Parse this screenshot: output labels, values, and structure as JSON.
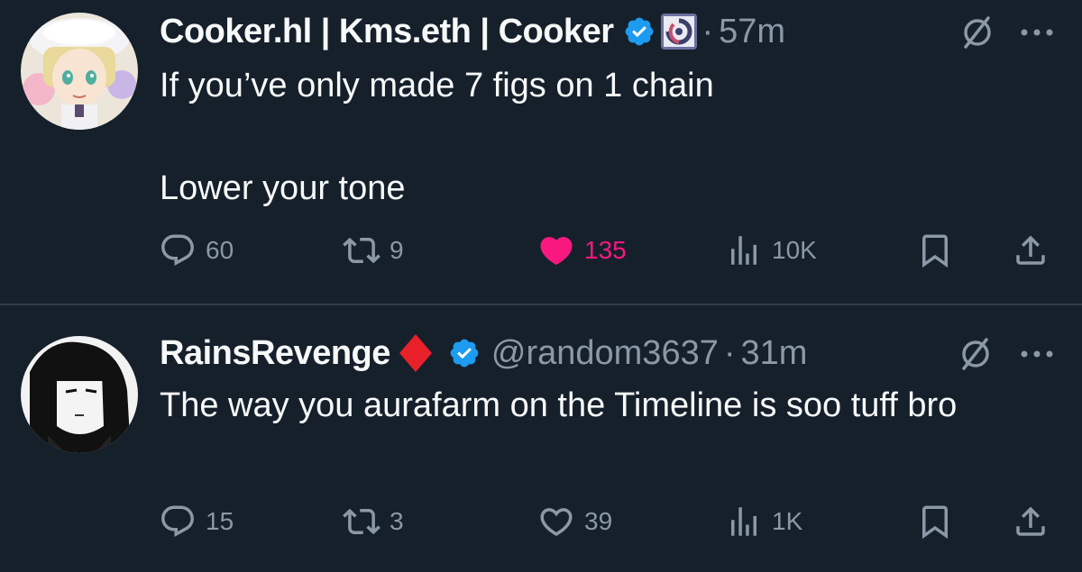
{
  "tweets": [
    {
      "author": "Cooker.hl | Kms.eth | Cooker",
      "handle": "",
      "time": "57m",
      "text": "If you’ve only made 7 figs on 1 chain\n\nLower your tone",
      "replies": "60",
      "retweets": "9",
      "likes": "135",
      "views": "10K",
      "liked": true
    },
    {
      "author": "RainsRevenge",
      "handle": "@random3637",
      "time": "31m",
      "text": "The way you aurafarm on the Timeline is soo tuff bro",
      "replies": "15",
      "retweets": "3",
      "likes": "39",
      "views": "1K",
      "liked": false
    }
  ],
  "dot": "·",
  "colors": {
    "background": "#15202b",
    "text": "#f7f9f9",
    "muted": "#8b98a5",
    "like_active": "#f91880",
    "verified": "#1d9bf0",
    "diamond": "#e8202a"
  },
  "icons": [
    "reply-icon",
    "retweet-icon",
    "like-icon",
    "views-icon",
    "bookmark-icon",
    "share-icon",
    "grok-icon",
    "more-icon",
    "verified-badge-icon"
  ]
}
